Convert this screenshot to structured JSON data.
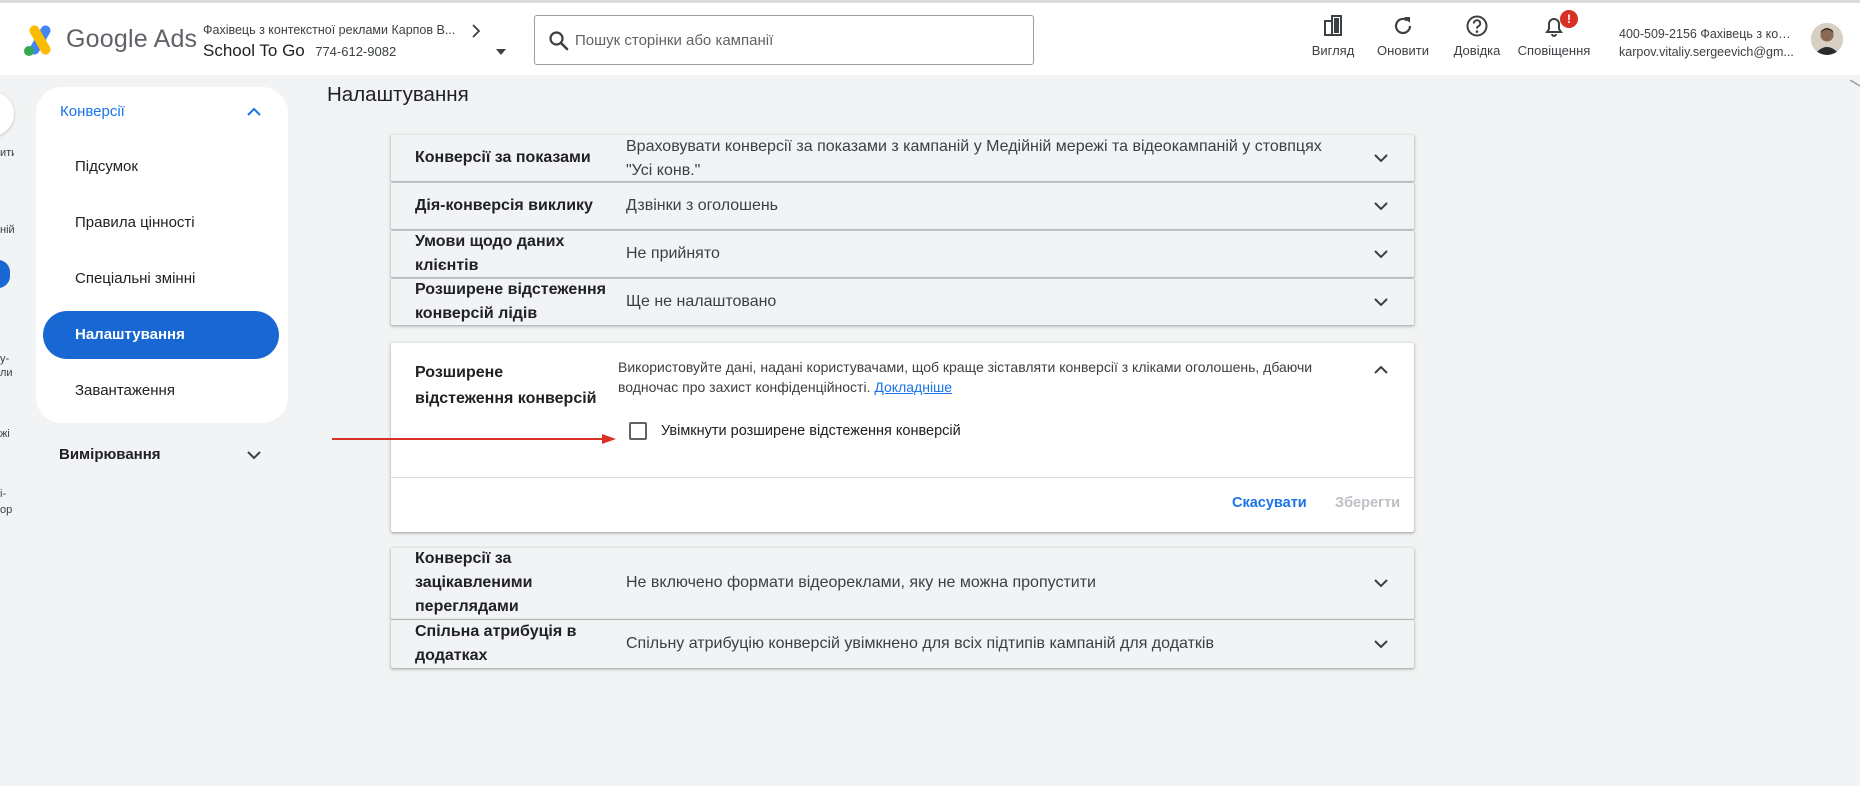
{
  "header": {
    "brand": "Google Ads",
    "account_line1": "Фахівець з контекстної реклами Карпов В...",
    "account_name": "School To Go",
    "account_id": "774-612-9082",
    "search_placeholder": "Пошук сторінки або кампанії",
    "tools": [
      {
        "label": "Вигляд",
        "icon": "appearance-icon"
      },
      {
        "label": "Оновити",
        "icon": "refresh-icon"
      },
      {
        "label": "Довідка",
        "icon": "help-icon"
      },
      {
        "label": "Сповіщення",
        "icon": "bell-icon",
        "badge": "!"
      }
    ],
    "user_line1": "400-509-2156 Фахівець з кон...",
    "user_line2": "karpov.vitaliy.sergeevich@gm..."
  },
  "edge_nav": [
    "ити",
    "ній",
    "у-",
    "ли",
    "жі",
    "і-",
    "ор"
  ],
  "sidebar": {
    "group_label": "Конверсії",
    "items": [
      {
        "label": "Підсумок",
        "active": false
      },
      {
        "label": "Правила цінності",
        "active": false
      },
      {
        "label": "Спеціальні змінні",
        "active": false
      },
      {
        "label": "Налаштування",
        "active": true
      },
      {
        "label": "Завантаження",
        "active": false
      }
    ],
    "collapsed_group": "Вимірювання"
  },
  "page_title": "Налаштування",
  "rows_top": [
    {
      "title": "Конверсії за показами",
      "value": "Враховувати конверсії за показами з кампаній у Медійній мережі та відеокампаній у стовпцях \"Усі конв.\""
    },
    {
      "title": "Дія-конверсія виклику",
      "value": "Дзвінки з оголошень"
    },
    {
      "title": "Умови щодо даних клієнтів",
      "value": "Не прийнято"
    },
    {
      "title": "Розширене відстеження конверсій лідів",
      "value": "Ще не налаштовано"
    }
  ],
  "panel": {
    "title": "Розширене відстеження конверсій",
    "description": "Використовуйте дані, надані користувачами, щоб краще зіставляти конверсії з кліками оголошень, дбаючи водночас про захист конфіденційності.",
    "learn_more": "Докладніше",
    "checkbox_label": "Увімкнути розширене відстеження конверсій",
    "checkbox_checked": false,
    "cancel_label": "Скасувати",
    "save_label": "Зберегти"
  },
  "rows_bottom": [
    {
      "title": "Конверсії за зацікавленими переглядами",
      "value": "Не включено формати відеореклами, яку не можна пропустити"
    },
    {
      "title": "Спільна атрибуція в додатках",
      "value": "Спільну атрибуцію конверсій увімкнено для всіх підтипів кампаній для додатків"
    }
  ],
  "colors": {
    "accent": "#1a73e8",
    "active_nav": "#1967d2",
    "annotation_arrow": "#d93025",
    "badge": "#d93025"
  }
}
